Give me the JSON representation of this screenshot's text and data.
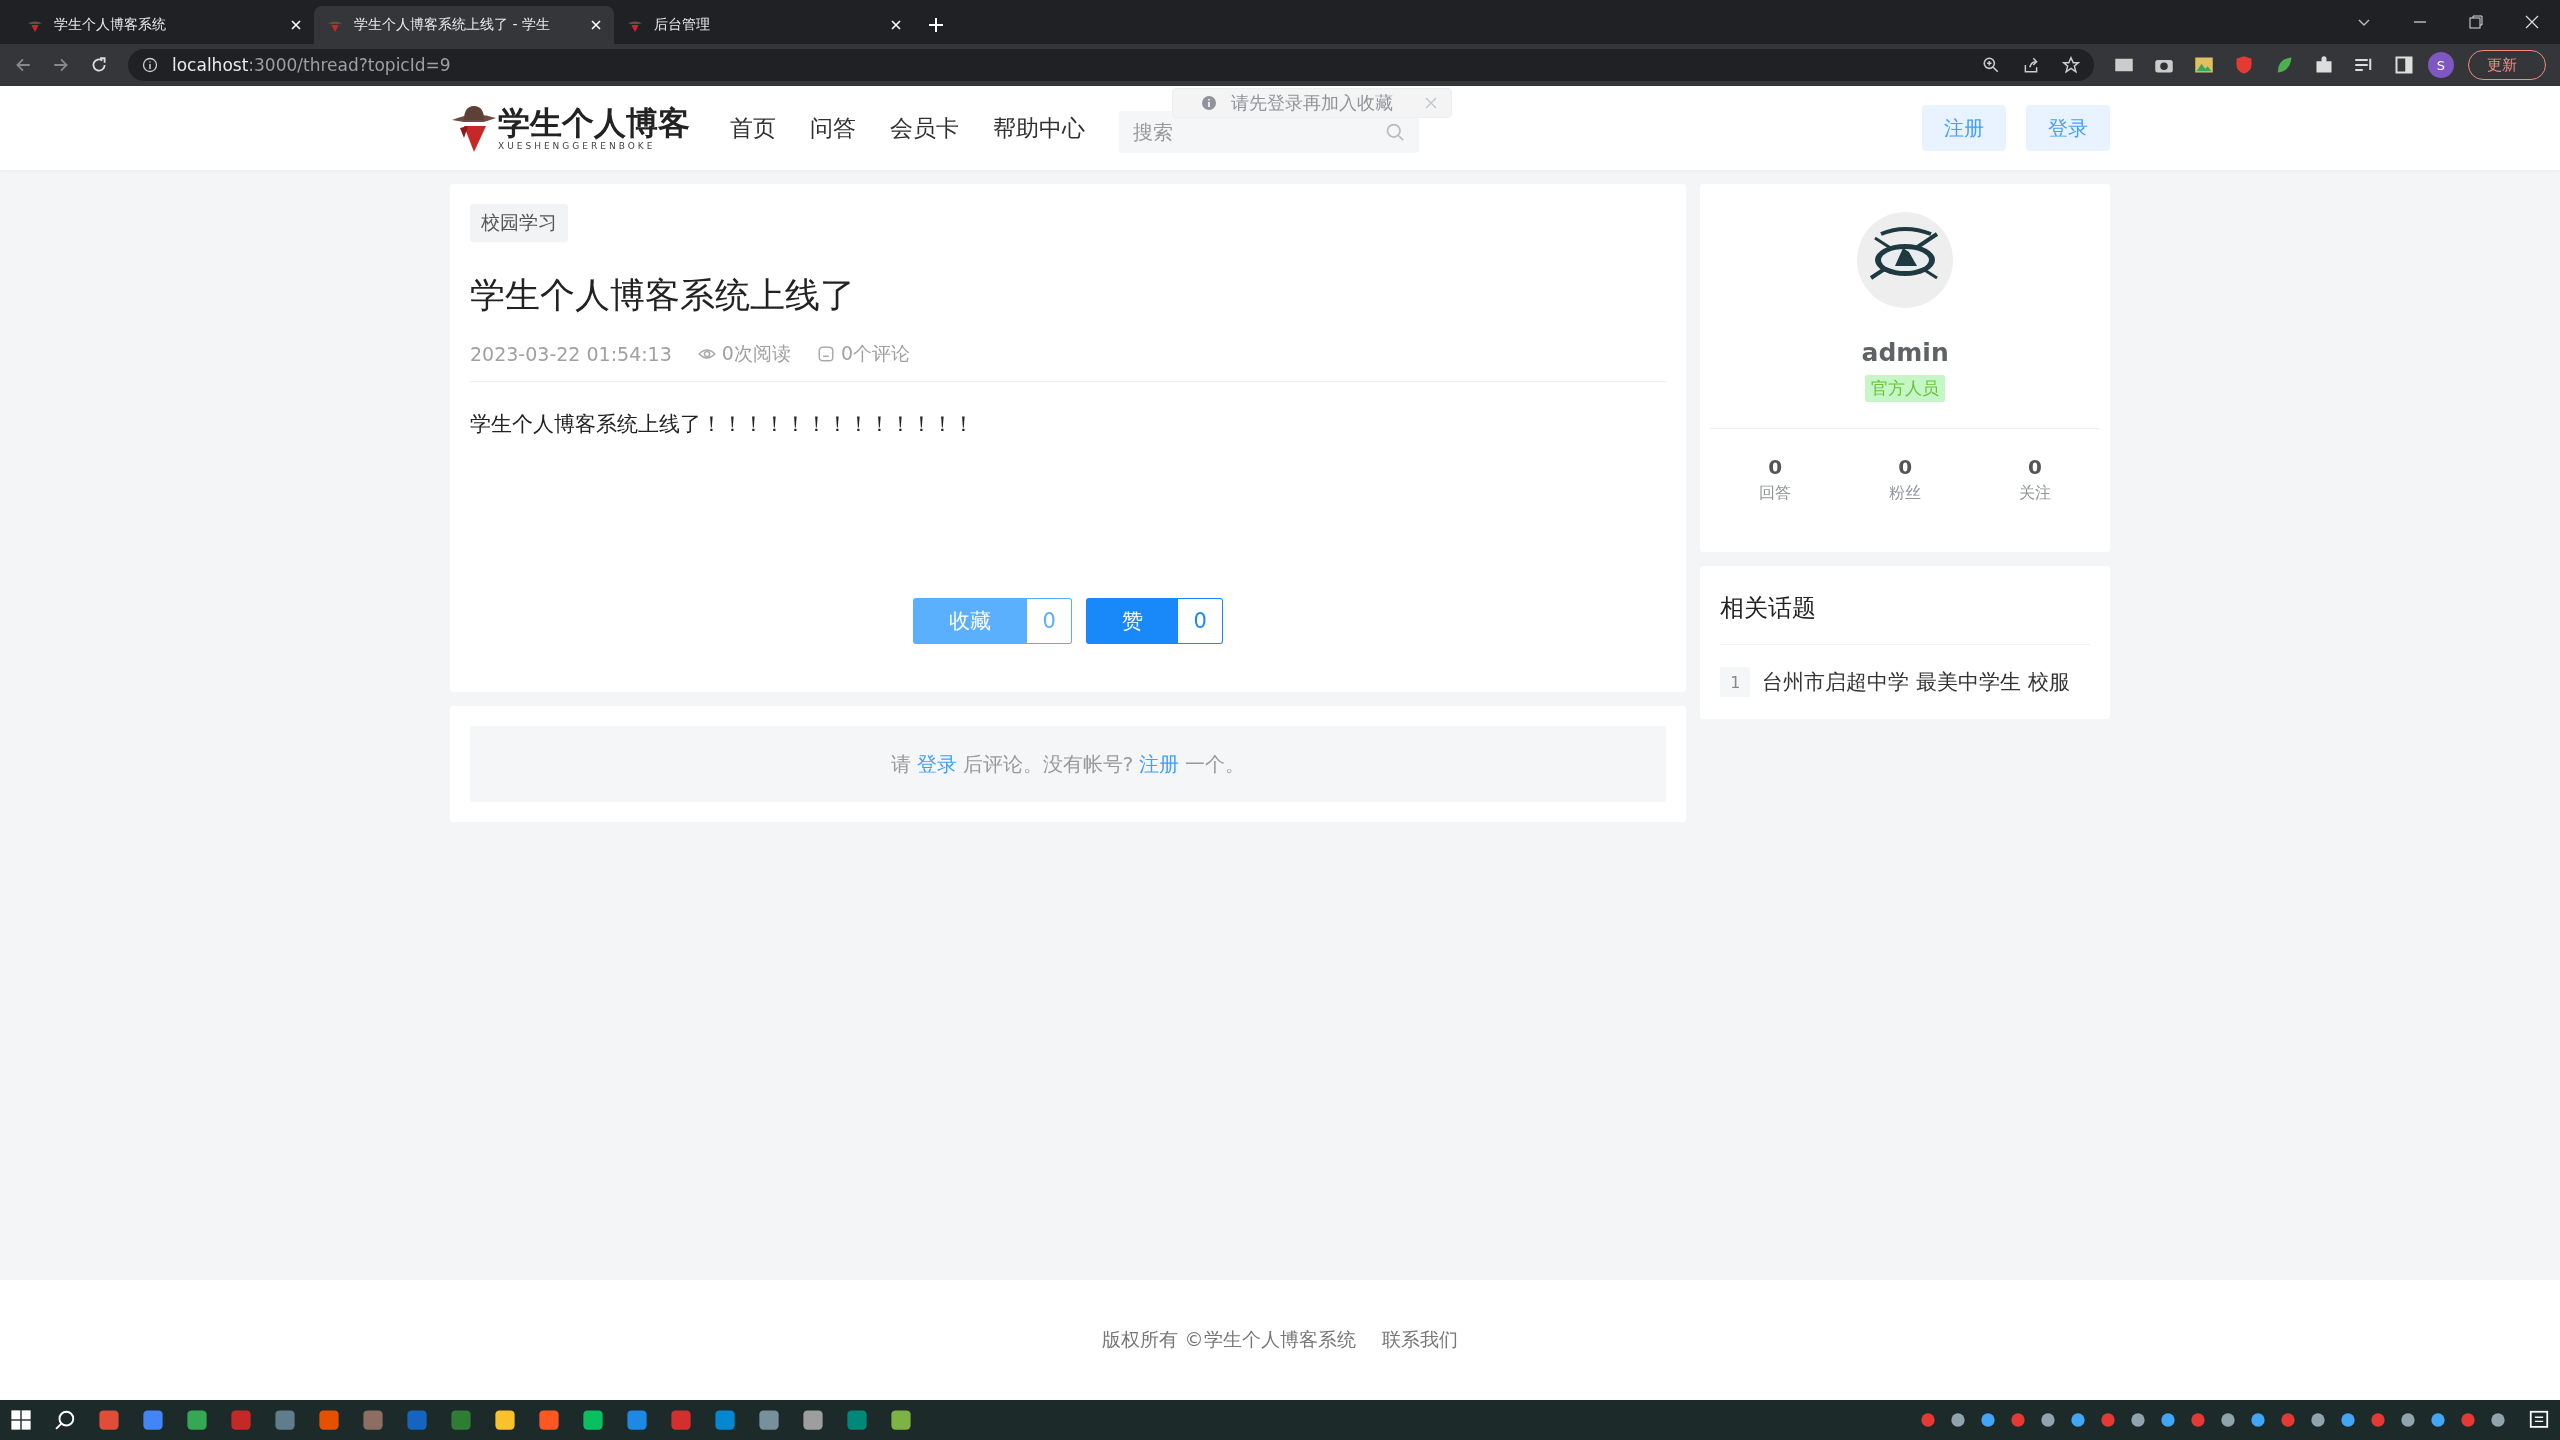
{
  "browser": {
    "tabs": [
      {
        "title": "学生个人博客系统",
        "selected": false
      },
      {
        "title": "学生个人博客系统上线了 - 学生",
        "selected": true
      },
      {
        "title": "后台管理",
        "selected": false
      }
    ],
    "address": {
      "host": "localhost",
      "path": ":3000/thread?topicId=9"
    },
    "update_button": "更新",
    "profile_initial": "S"
  },
  "header": {
    "logo": {
      "title": "学生个人博客",
      "subtitle": "XUESHENGGERENBOKE"
    },
    "nav": [
      {
        "label": "首页"
      },
      {
        "label": "问答"
      },
      {
        "label": "会员卡"
      },
      {
        "label": "帮助中心"
      }
    ],
    "search": {
      "placeholder": "搜索"
    },
    "toast": {
      "message": "请先登录再加入收藏"
    },
    "buttons": [
      {
        "label": "注册"
      },
      {
        "label": "登录"
      }
    ]
  },
  "article": {
    "tag": "校园学习",
    "title": "学生个人博客系统上线了",
    "date": "2023-03-22 01:54:13",
    "views": "0次阅读",
    "comments": "0个评论",
    "body": "学生个人博客系统上线了！！！！！！！！！！！！！",
    "actions": [
      {
        "kind": "favorite",
        "label": "收藏",
        "count": "0"
      },
      {
        "kind": "like",
        "label": "赞",
        "count": "0"
      }
    ]
  },
  "comment_prompt": [
    {
      "text": "请",
      "link": false
    },
    {
      "text": "登录",
      "link": true
    },
    {
      "text": "后评论。没有帐号?",
      "link": false
    },
    {
      "text": "注册",
      "link": true
    },
    {
      "text": "一个。",
      "link": false
    }
  ],
  "profile": {
    "name": "admin",
    "badge": "官方人员",
    "stats": [
      {
        "value": "0",
        "label": "回答"
      },
      {
        "value": "0",
        "label": "粉丝"
      },
      {
        "value": "0",
        "label": "关注"
      }
    ]
  },
  "related": {
    "title": "相关话题",
    "items": [
      {
        "index": "1",
        "title": "台州市启超中学 最美中学生 校服"
      }
    ]
  },
  "footer": {
    "copyright": "版权所有 ©学生个人博客系统",
    "contact": "联系我们"
  }
}
